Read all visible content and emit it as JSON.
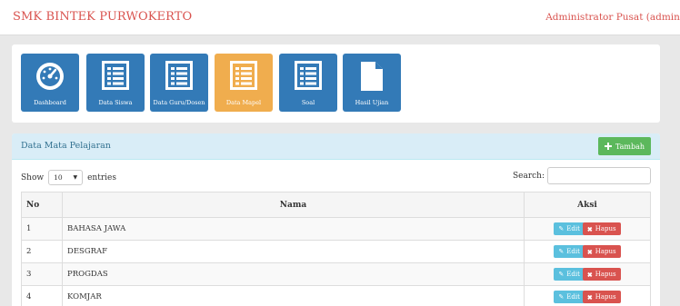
{
  "header": {
    "brand": "SMK BINTEK PURWOKERTO",
    "user": "Administrator Pusat (admin)"
  },
  "menu": {
    "tiles": [
      {
        "label": "Dashboard",
        "icon": "dashboard-icon",
        "active": false
      },
      {
        "label": "Data Siswa",
        "icon": "list-icon",
        "active": false
      },
      {
        "label": "Data Guru/Dosen",
        "icon": "list-icon",
        "active": false
      },
      {
        "label": "Data Mapel",
        "icon": "list-icon",
        "active": true
      },
      {
        "label": "Soal",
        "icon": "list-icon",
        "active": false
      },
      {
        "label": "Hasil Ujian",
        "icon": "file-icon",
        "active": false
      }
    ]
  },
  "panel": {
    "title": "Data Mata Pelajaran",
    "add_label": "Tambah"
  },
  "controls": {
    "show_label": "Show",
    "page_size": "10",
    "entries_label": "entries",
    "search_label": "Search:",
    "search_value": ""
  },
  "table": {
    "headers": {
      "no": "No",
      "nama": "Nama",
      "aksi": "Aksi"
    },
    "edit_label": "Edit",
    "hapus_label": "Hapus",
    "rows": [
      {
        "no": "1",
        "nama": "BAHASA JAWA"
      },
      {
        "no": "2",
        "nama": "DESGRAF"
      },
      {
        "no": "3",
        "nama": "PROGDAS"
      },
      {
        "no": "4",
        "nama": "KOMJAR"
      }
    ]
  },
  "colors": {
    "brand": "#d9534f",
    "tile": "#337ab7",
    "tile_active": "#f0ad4e",
    "success": "#5cb85c",
    "info": "#5bc0de",
    "danger": "#d9534f"
  }
}
